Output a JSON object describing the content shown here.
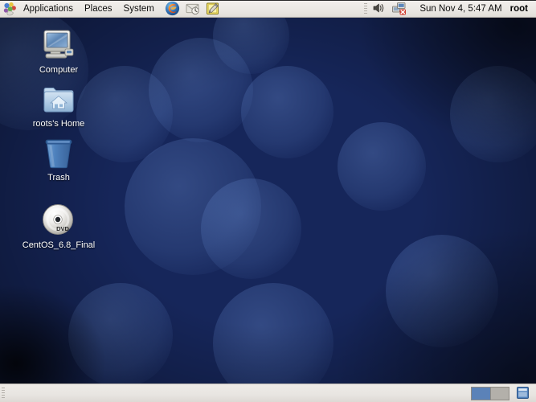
{
  "top_panel": {
    "logo_icon": "gnome-foot-icon",
    "menus": [
      {
        "label": "Applications",
        "name": "menu-applications"
      },
      {
        "label": "Places",
        "name": "menu-places"
      },
      {
        "label": "System",
        "name": "menu-system"
      }
    ],
    "launchers": [
      {
        "name": "firefox-launcher",
        "icon": "firefox-icon",
        "title": "Firefox Web Browser"
      },
      {
        "name": "evolution-launcher",
        "icon": "email-clock-icon",
        "title": "Evolution Mail"
      },
      {
        "name": "text-editor-launcher",
        "icon": "notepad-pencil-icon",
        "title": "Text Editor"
      }
    ],
    "tray": {
      "volume_icon": "speaker-volume-icon",
      "network_icon": "network-disconnected-icon",
      "clock": "Sun Nov  4,  5:47 AM",
      "user": "root"
    }
  },
  "desktop": {
    "icons": [
      {
        "name": "desktop-icon-computer",
        "icon": "computer-monitor-icon",
        "label": "Computer"
      },
      {
        "name": "desktop-icon-home",
        "icon": "home-folder-icon",
        "label": "roots's Home"
      },
      {
        "name": "desktop-icon-trash",
        "icon": "trash-bin-icon",
        "label": "Trash"
      },
      {
        "name": "desktop-icon-dvd",
        "icon": "dvd-disc-icon",
        "label": "CentOS_6.8_Final"
      }
    ]
  },
  "bottom_panel": {
    "workspaces": [
      {
        "name": "workspace-1",
        "active": true
      },
      {
        "name": "workspace-2",
        "active": false
      }
    ],
    "show_desktop_icon": "window-list-icon"
  },
  "colors": {
    "panel_bg": "#ebe8e4",
    "desktop_blue": "#1b2d68",
    "workspace_active": "#5b82b8",
    "icon_label": "#ffffff"
  }
}
